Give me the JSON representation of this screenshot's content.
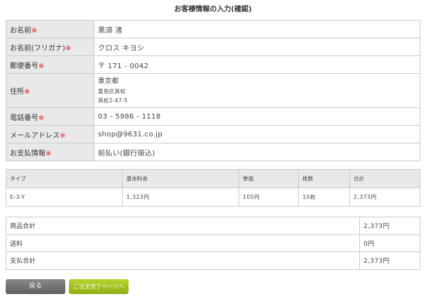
{
  "title": "お客様情報の入力(確認)",
  "required_mark": "※",
  "customer": [
    {
      "label": "お名前",
      "value": "黒須 渚"
    },
    {
      "label": "お名前(フリガナ)",
      "value": "クロス キヨシ"
    },
    {
      "label": "郵便番号",
      "value": "〒 171 - 0042"
    },
    {
      "label": "住所",
      "value_lines": [
        "東京都",
        "豊島区高松",
        "高松2-47-5"
      ]
    },
    {
      "label": "電話番号",
      "value": "03 - 5986 - 1118"
    },
    {
      "label": "メールアドレス",
      "value": "shop@9631.co.jp"
    },
    {
      "label": "お支払情報",
      "value": "前払い(銀行振込)"
    }
  ],
  "order": {
    "headers": [
      "タイプ",
      "基本料金",
      "単価",
      "枚数",
      "合計"
    ],
    "rows": [
      [
        "E-3-Y",
        "1,323円",
        "105円",
        "10枚",
        "2,373円"
      ]
    ]
  },
  "totals": [
    {
      "label": "商品合計",
      "value": "2,373円"
    },
    {
      "label": "送料",
      "value": "0円"
    },
    {
      "label": "支払合計",
      "value": "2,373円"
    }
  ],
  "buttons": {
    "back": "戻る",
    "next": "ご注文完了ページへ"
  },
  "colors": {
    "label_bg": "#e9e9e9",
    "required": "#e02020",
    "back_button": "#6b6b6b",
    "next_button": "#9fc21e"
  }
}
